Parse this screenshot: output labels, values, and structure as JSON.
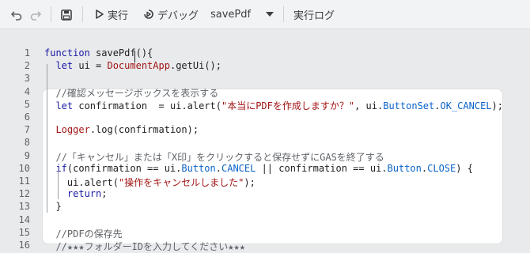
{
  "toolbar": {
    "run_label": "実行",
    "debug_label": "デバッグ",
    "function_select_value": "savePdf",
    "log_label": "実行ログ"
  },
  "editor": {
    "line_numbers": [
      "1",
      "2",
      "3",
      "4",
      "5",
      "6",
      "7",
      "8",
      "9",
      "10",
      "11",
      "12",
      "13",
      "14",
      "15",
      "16"
    ],
    "lines": [
      [
        {
          "t": "kw",
          "v": "function "
        },
        {
          "t": "fn",
          "v": "savePdf(){"
        }
      ],
      [
        {
          "t": "fn",
          "v": "  "
        },
        {
          "t": "kw",
          "v": "let "
        },
        {
          "t": "fn",
          "v": "ui = "
        },
        {
          "t": "cls",
          "v": "DocumentApp"
        },
        {
          "t": "fn",
          "v": ".getUi();"
        }
      ],
      [],
      [
        {
          "t": "cm",
          "v": "  //確認メッセージボックスを表示する"
        }
      ],
      [
        {
          "t": "fn",
          "v": "  "
        },
        {
          "t": "kw",
          "v": "let "
        },
        {
          "t": "fn",
          "v": "confirmation  = ui.alert("
        },
        {
          "t": "str",
          "v": "\"本当にPDFを作成しますか？\""
        },
        {
          "t": "fn",
          "v": ", ui."
        },
        {
          "t": "prop",
          "v": "ButtonSet"
        },
        {
          "t": "fn",
          "v": "."
        },
        {
          "t": "prop",
          "v": "OK_CANCEL"
        },
        {
          "t": "fn",
          "v": ");"
        }
      ],
      [],
      [
        {
          "t": "fn",
          "v": "  "
        },
        {
          "t": "cls",
          "v": "Logger"
        },
        {
          "t": "fn",
          "v": ".log(confirmation);"
        }
      ],
      [],
      [
        {
          "t": "cm",
          "v": "  //「キャンセル」または「X印」をクリックすると保存せずにGASを終了する"
        }
      ],
      [
        {
          "t": "fn",
          "v": "  "
        },
        {
          "t": "kw",
          "v": "if"
        },
        {
          "t": "fn",
          "v": "(confirmation == ui."
        },
        {
          "t": "prop",
          "v": "Button"
        },
        {
          "t": "fn",
          "v": "."
        },
        {
          "t": "prop",
          "v": "CANCEL"
        },
        {
          "t": "fn",
          "v": " || confirmation == ui."
        },
        {
          "t": "prop",
          "v": "Button"
        },
        {
          "t": "fn",
          "v": "."
        },
        {
          "t": "prop",
          "v": "CLOSE"
        },
        {
          "t": "fn",
          "v": ") {"
        }
      ],
      [
        {
          "t": "fn",
          "v": "    ui.alert("
        },
        {
          "t": "str",
          "v": "\"操作をキャンセルしました\""
        },
        {
          "t": "fn",
          "v": ");"
        }
      ],
      [
        {
          "t": "fn",
          "v": "    "
        },
        {
          "t": "kw",
          "v": "return"
        },
        {
          "t": "fn",
          "v": ";"
        }
      ],
      [
        {
          "t": "fn",
          "v": "  }"
        }
      ],
      [],
      [
        {
          "t": "cm",
          "v": "  //PDFの保存先"
        }
      ],
      [
        {
          "t": "cm",
          "v": "  //★★★フォルダーIDを入力してください★★★"
        }
      ]
    ]
  }
}
